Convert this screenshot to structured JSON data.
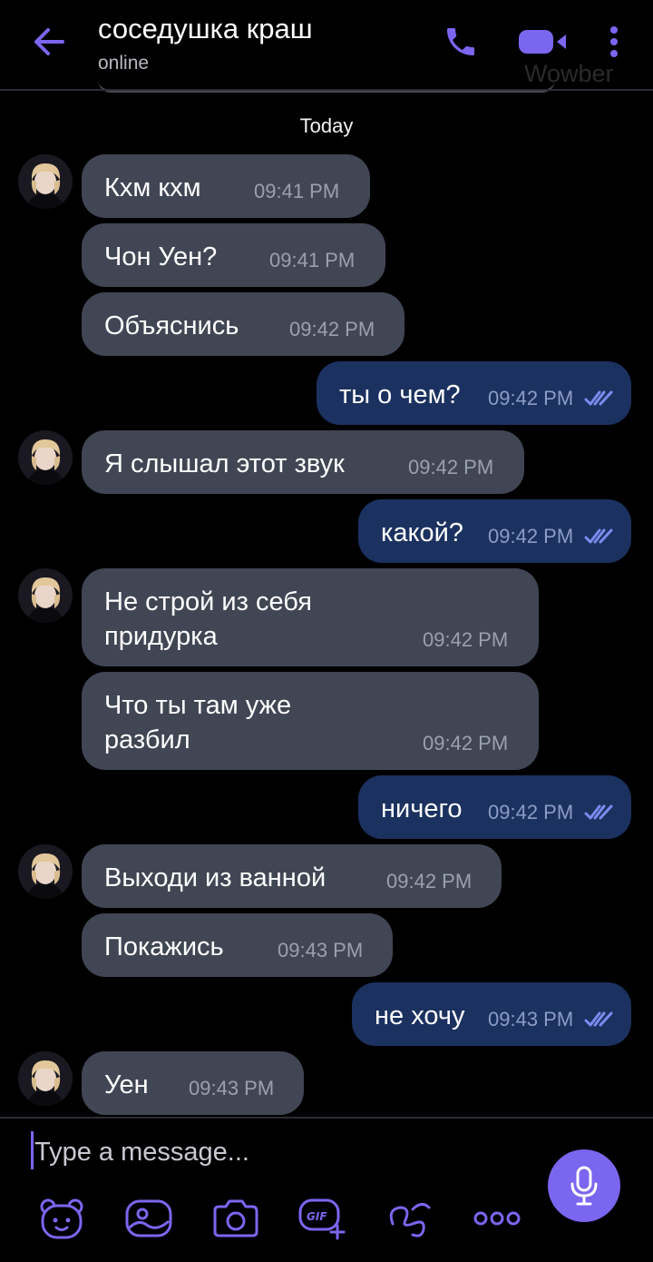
{
  "header": {
    "title": "соседушка краш",
    "status": "online",
    "watermark": "Wowber",
    "icons": [
      "back-arrow-icon",
      "phone-icon",
      "video-camera-icon",
      "more-vertical-icon"
    ]
  },
  "date_separator": "Today",
  "messages": [
    {
      "dir": "in",
      "avatar": true,
      "text": "Кхм кхм",
      "time": "09:41 PM"
    },
    {
      "dir": "in",
      "avatar": false,
      "text": "Чон Уен?",
      "time": "09:41 PM"
    },
    {
      "dir": "in",
      "avatar": false,
      "text": "Объяснись",
      "time": "09:42 PM"
    },
    {
      "dir": "out",
      "text": "ты о чем?",
      "time": "09:42 PM",
      "read": true
    },
    {
      "dir": "in",
      "avatar": true,
      "text": "Я слышал этот звук",
      "time": "09:42 PM"
    },
    {
      "dir": "out",
      "text": "какой?",
      "time": "09:42 PM",
      "read": true
    },
    {
      "dir": "in",
      "avatar": true,
      "lines": [
        "Не строй из себя",
        "придурка"
      ],
      "time": "09:42 PM"
    },
    {
      "dir": "in",
      "avatar": false,
      "lines": [
        "Что ты там уже",
        "разбил"
      ],
      "time": "09:42 PM"
    },
    {
      "dir": "out",
      "text": "ничего",
      "time": "09:42 PM",
      "read": true
    },
    {
      "dir": "in",
      "avatar": true,
      "text": "Выходи из ванной",
      "time": "09:42 PM"
    },
    {
      "dir": "in",
      "avatar": false,
      "text": "Покажись",
      "time": "09:43 PM"
    },
    {
      "dir": "out",
      "text": "не хочу",
      "time": "09:43 PM",
      "read": true
    },
    {
      "dir": "in",
      "avatar": true,
      "text": "Уен",
      "time": "09:43 PM"
    }
  ],
  "composer": {
    "placeholder": "Type a message...",
    "toolbar_icons": [
      "sticker-bear-icon",
      "gallery-icon",
      "camera-icon",
      "gif-icon",
      "doodle-icon",
      "more-icon"
    ],
    "send_icon": "microphone-icon"
  },
  "colors": {
    "background": "#000000",
    "incoming_bubble": "#414654",
    "outgoing_bubble": "#1b3160",
    "accent": "#7b66f0",
    "read_check": "#7a8cf0"
  }
}
